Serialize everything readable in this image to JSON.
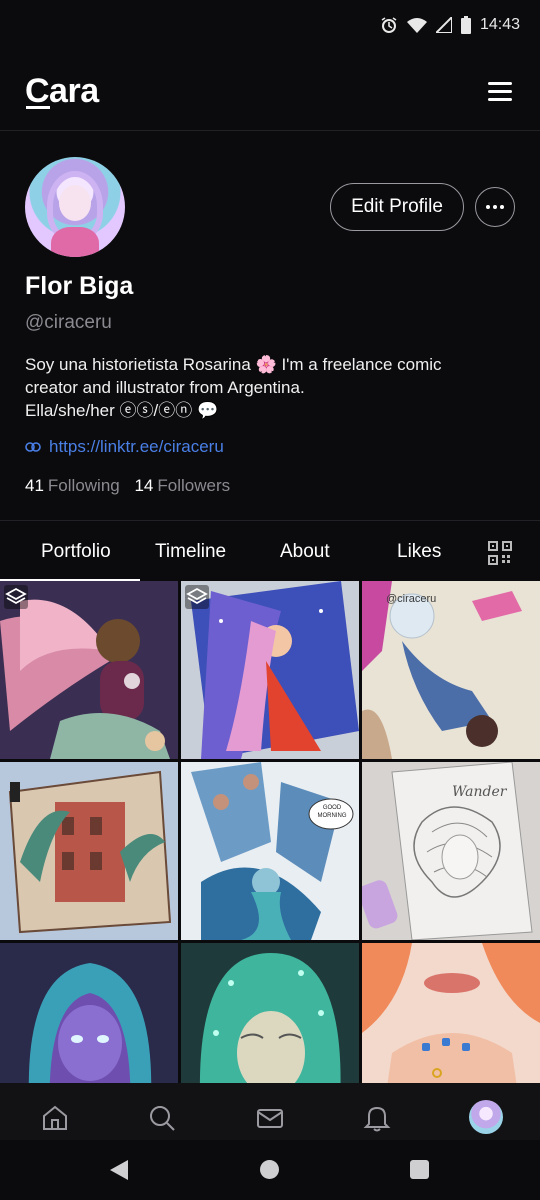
{
  "status_bar": {
    "time": "14:43"
  },
  "app": {
    "logo": "Cara",
    "menu_icon": "hamburger-menu-icon"
  },
  "profile": {
    "display_name": "Flor Biga",
    "handle": "@ciraceru",
    "bio_line1": "Soy una historietista Rosarina 🌸 I'm a freelance comic",
    "bio_line2": "creator and illustrator from Argentina.",
    "bio_line3": "Ella/she/her  ⓔⓢ/ⓔⓝ 💬",
    "link": "https://linktr.ee/ciraceru",
    "following_count": "41",
    "following_label": "Following",
    "followers_count": "14",
    "followers_label": "Followers",
    "edit_button": "Edit Profile"
  },
  "tabs": [
    {
      "label": "Portfolio",
      "active": true
    },
    {
      "label": "Timeline",
      "active": false
    },
    {
      "label": "About",
      "active": false
    },
    {
      "label": "Likes",
      "active": false
    }
  ],
  "grid": {
    "tiles": [
      {
        "name": "winged-girl-artwork",
        "multi_image": true
      },
      {
        "name": "pink-haired-girl-sketchbook",
        "multi_image": true
      },
      {
        "name": "crystal-ball-figure-sketchbook",
        "multi_image": false,
        "watermark": "@ciraceru"
      },
      {
        "name": "tentacle-building-sketchbook",
        "multi_image": false
      },
      {
        "name": "good-morning-mermaid-artwork",
        "multi_image": false,
        "speech_bubble": "GOOD MORNING"
      },
      {
        "name": "wander-notebook-lineart",
        "multi_image": false,
        "notebook_title": "Wander"
      },
      {
        "name": "hooded-girl-portrait",
        "multi_image": false
      },
      {
        "name": "crystal-hair-portrait",
        "multi_image": false
      },
      {
        "name": "hands-with-rings-artwork",
        "multi_image": false
      }
    ]
  },
  "bottom_nav": [
    "home-icon",
    "search-icon",
    "mail-icon",
    "bell-icon",
    "profile-avatar"
  ],
  "colors": {
    "background": "#0b0b0d",
    "link": "#4a7fe6",
    "muted": "#8a8a90"
  }
}
